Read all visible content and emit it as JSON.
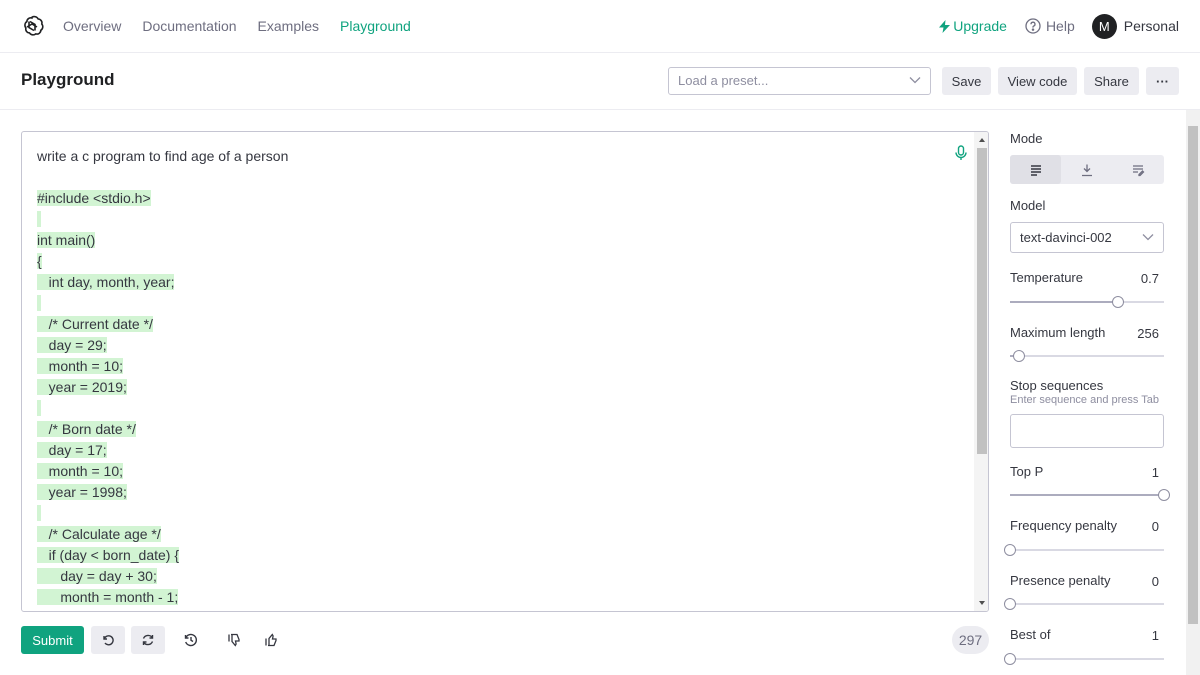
{
  "nav": {
    "links": [
      "Overview",
      "Documentation",
      "Examples",
      "Playground"
    ],
    "upgrade": "Upgrade",
    "help": "Help",
    "avatar_letter": "M",
    "account": "Personal"
  },
  "header": {
    "title": "Playground",
    "preset_placeholder": "Load a preset...",
    "save": "Save",
    "view_code": "View code",
    "share": "Share",
    "more": "···"
  },
  "editor": {
    "prompt": "write a c program to find age of a person",
    "code_lines": [
      "#include <stdio.h>",
      "",
      "int main()",
      "{",
      "   int day, month, year;",
      "",
      "   /* Current date */",
      "   day = 29;",
      "   month = 10;",
      "   year = 2019;",
      "",
      "   /* Born date */",
      "   day = 17;",
      "   month = 10;",
      "   year = 1998;",
      "",
      "   /* Calculate age */",
      "   if (day < born_date) {",
      "      day = day + 30;",
      "      month = month - 1;"
    ]
  },
  "bottom": {
    "submit": "Submit",
    "token_count": "297"
  },
  "settings": {
    "mode_label": "Mode",
    "model_label": "Model",
    "model_value": "text-davinci-002",
    "temperature": {
      "label": "Temperature",
      "value": "0.7",
      "fraction": 0.7
    },
    "max_length": {
      "label": "Maximum length",
      "value": "256",
      "fraction": 0.06
    },
    "stop_label": "Stop sequences",
    "stop_hint": "Enter sequence and press Tab",
    "top_p": {
      "label": "Top P",
      "value": "1",
      "fraction": 1.0
    },
    "frequency_penalty": {
      "label": "Frequency penalty",
      "value": "0",
      "fraction": 0.0
    },
    "presence_penalty": {
      "label": "Presence penalty",
      "value": "0",
      "fraction": 0.0
    },
    "best_of": {
      "label": "Best of",
      "value": "1",
      "fraction": 0.0
    }
  },
  "colors": {
    "accent": "#10a37f",
    "highlight": "#d2f4d3"
  }
}
